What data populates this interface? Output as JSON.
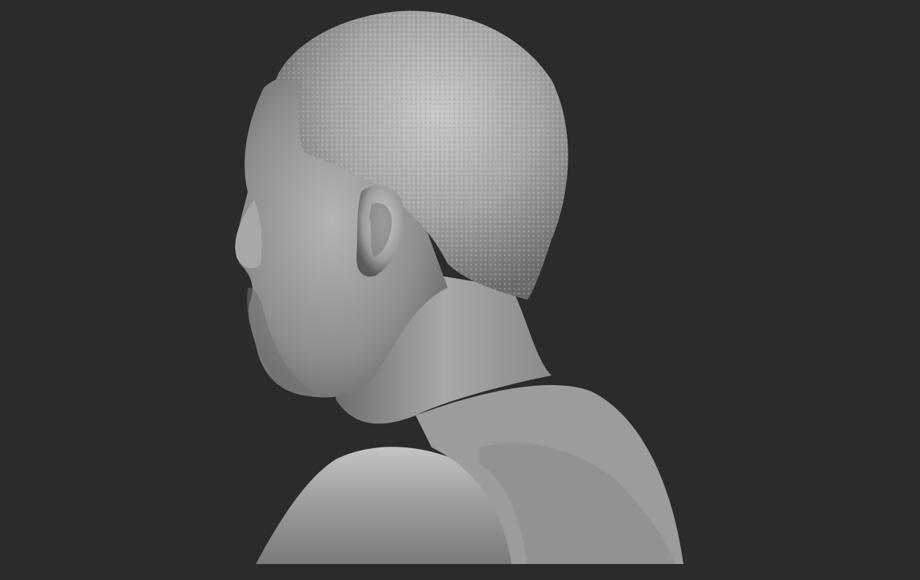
{
  "scene": {
    "background_color": "#2b2b2b",
    "model_color": "#9a9a9a",
    "subject": "bust-sculpt"
  }
}
